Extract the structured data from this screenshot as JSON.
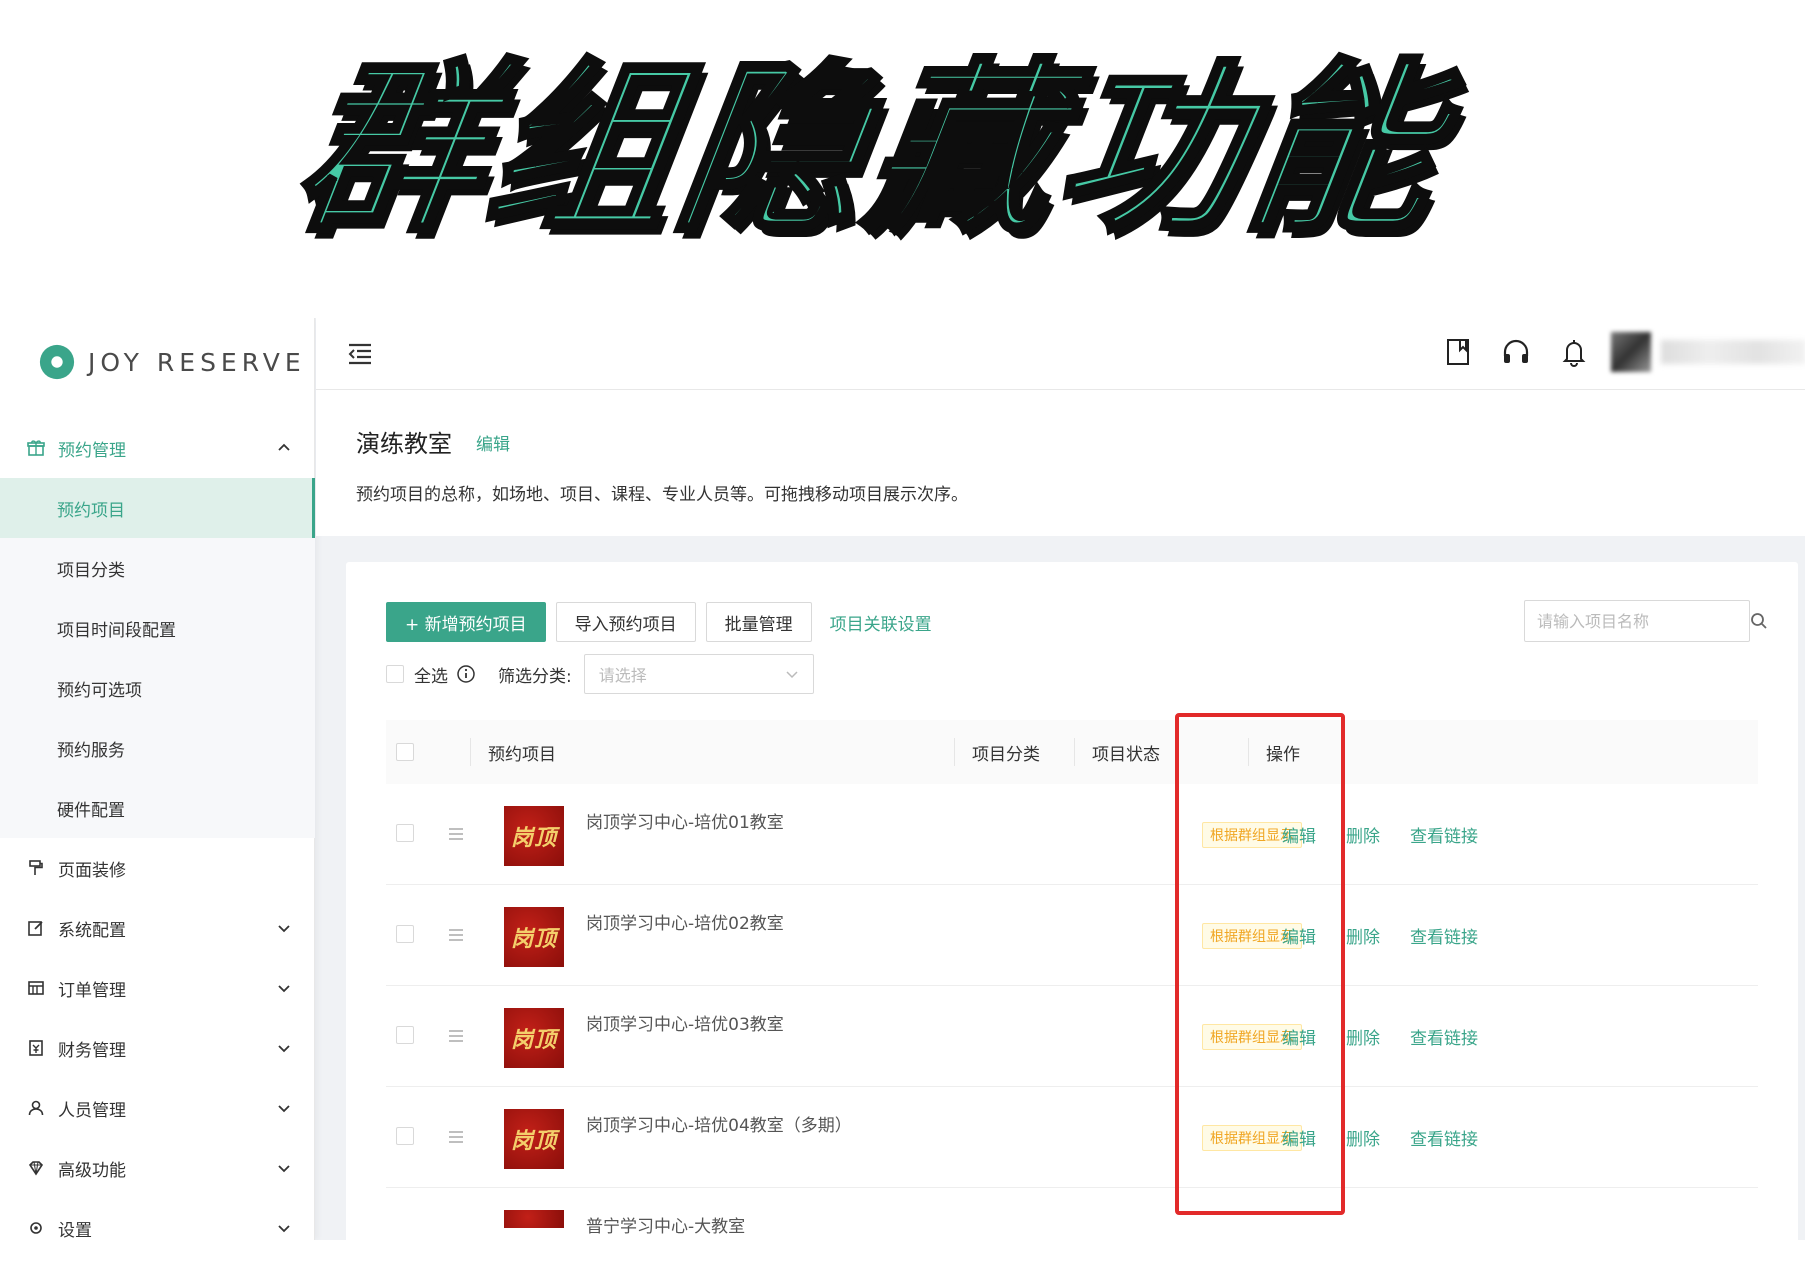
{
  "banner": {
    "title": "群组隐藏功能"
  },
  "brand": {
    "name": "JOY RESERVE"
  },
  "colors": {
    "accent": "#3aa58a",
    "warning": "#f0a623",
    "highlight": "#e22a2a",
    "banner_fill": "#46c9a5"
  },
  "sidebar": {
    "group_booking": {
      "label": "预约管理",
      "icon": "gift-icon"
    },
    "sub_items": [
      {
        "label": "预约项目",
        "selected": true
      },
      {
        "label": "项目分类"
      },
      {
        "label": "项目时间段配置"
      },
      {
        "label": "预约可选项"
      },
      {
        "label": "预约服务"
      },
      {
        "label": "硬件配置"
      }
    ],
    "groups": [
      {
        "label": "页面装修",
        "icon": "paint-roller-icon",
        "has_chevron": false
      },
      {
        "label": "系统配置",
        "icon": "edit-icon",
        "has_chevron": true
      },
      {
        "label": "订单管理",
        "icon": "table-icon",
        "has_chevron": true
      },
      {
        "label": "财务管理",
        "icon": "finance-icon",
        "has_chevron": true
      },
      {
        "label": "人员管理",
        "icon": "user-icon",
        "has_chevron": true
      },
      {
        "label": "高级功能",
        "icon": "diamond-icon",
        "has_chevron": true
      },
      {
        "label": "设置",
        "icon": "settings-icon",
        "has_chevron": true
      }
    ]
  },
  "header": {
    "icons": [
      "book-icon",
      "headset-icon",
      "bell-icon"
    ]
  },
  "page": {
    "title": "演练教室",
    "edit_label": "编辑",
    "description": "预约项目的总称，如场地、项目、课程、专业人员等。可拖拽移动项目展示次序。"
  },
  "toolbar": {
    "add_label": "+ 新增预约项目",
    "import_label": "导入预约项目",
    "batch_label": "批量管理",
    "link_settings_label": "项目关联设置",
    "search_placeholder": "请输入项目名称"
  },
  "filter": {
    "select_all_label": "全选",
    "category_label": "筛选分类:",
    "category_placeholder": "请选择"
  },
  "table": {
    "columns": {
      "item": "预约项目",
      "category": "项目分类",
      "status": "项目状态",
      "actions": "操作"
    },
    "thumb_text": "岗顶",
    "action_labels": {
      "edit": "编辑",
      "delete": "删除",
      "view_link": "查看链接"
    },
    "rows": [
      {
        "name": "岗顶学习中心-培优01教室",
        "category": "",
        "status": "根据群组显示"
      },
      {
        "name": "岗顶学习中心-培优02教室",
        "category": "",
        "status": "根据群组显示"
      },
      {
        "name": "岗顶学习中心-培优03教室",
        "category": "",
        "status": "根据群组显示"
      },
      {
        "name": "岗顶学习中心-培优04教室（多期）",
        "category": "",
        "status": "根据群组显示"
      },
      {
        "name": "普宁学习中心-大教室",
        "category": "",
        "status": ""
      }
    ]
  }
}
